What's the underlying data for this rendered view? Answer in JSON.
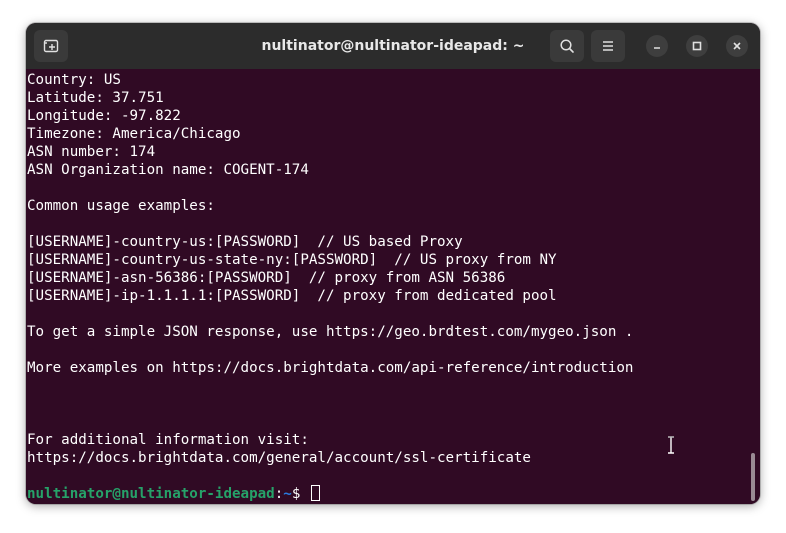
{
  "window": {
    "title": "nultinator@nultinator-ideapad: ~"
  },
  "titlebar": {
    "new_tab_icon": "new-tab-icon",
    "search_icon": "search-icon",
    "menu_icon": "hamburger-menu-icon",
    "minimize_icon": "minimize-icon",
    "maximize_icon": "maximize-icon",
    "close_icon": "close-icon"
  },
  "terminal": {
    "lines": [
      "Country: US",
      "Latitude: 37.751",
      "Longitude: -97.822",
      "Timezone: America/Chicago",
      "ASN number: 174",
      "ASN Organization name: COGENT-174",
      "",
      "Common usage examples:",
      "",
      "[USERNAME]-country-us:[PASSWORD]  // US based Proxy",
      "[USERNAME]-country-us-state-ny:[PASSWORD]  // US proxy from NY",
      "[USERNAME]-asn-56386:[PASSWORD]  // proxy from ASN 56386",
      "[USERNAME]-ip-1.1.1.1:[PASSWORD]  // proxy from dedicated pool",
      "",
      "To get a simple JSON response, use https://geo.brdtest.com/mygeo.json .",
      "",
      "More examples on https://docs.brightdata.com/api-reference/introduction",
      "",
      "",
      "",
      "For additional information visit:",
      "https://docs.brightdata.com/general/account/ssl-certificate",
      ""
    ],
    "prompt": {
      "user_host": "nultinator@nultinator-ideapad",
      "separator": ":",
      "path": "~",
      "symbol": "$ "
    }
  },
  "colors": {
    "terminal_bg": "#300a24",
    "titlebar_bg": "#2c2c2c",
    "prompt_user": "#26a269",
    "prompt_path": "#2a7bde",
    "text": "#ffffff"
  }
}
